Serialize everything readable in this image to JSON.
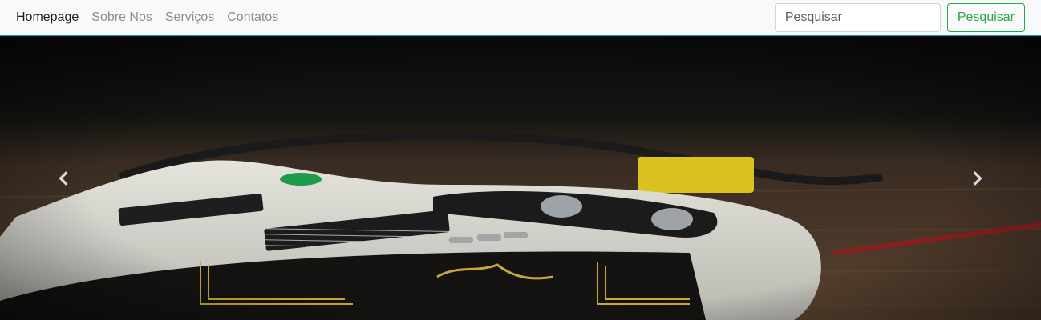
{
  "navbar": {
    "links": [
      {
        "label": "Homepage",
        "active": true
      },
      {
        "label": "Sobre Nos",
        "active": false
      },
      {
        "label": "Serviços",
        "active": false
      },
      {
        "label": "Contatos",
        "active": false
      }
    ],
    "search": {
      "placeholder": "Pesquisar",
      "value": "",
      "button_label": "Pesquisar"
    }
  },
  "carousel": {
    "image": "electric-guitar-with-fender-strap",
    "prev_icon": "chevron-left-icon",
    "next_icon": "chevron-right-icon"
  },
  "colors": {
    "navbar_bg": "#f8f9fa",
    "accent_green": "#28a745",
    "navbar_border": "#2b8fb5"
  }
}
